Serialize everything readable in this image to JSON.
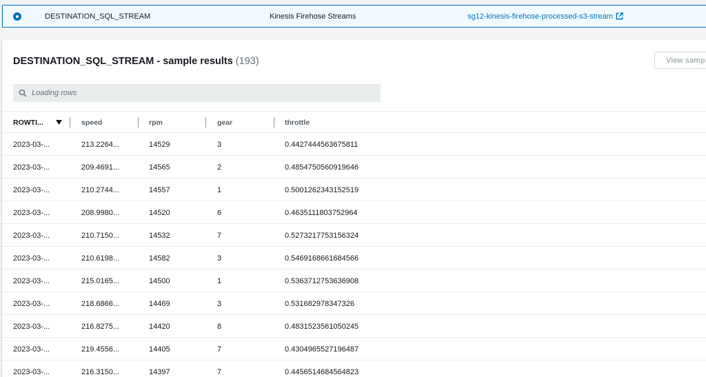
{
  "destination": {
    "name": "DESTINATION_SQL_STREAM",
    "type": "Kinesis Firehose Streams",
    "link": "sg12-kinesis-firehose-processed-s3-stream"
  },
  "panel": {
    "title": "DESTINATION_SQL_STREAM - sample results",
    "count": "(193)",
    "view_button": "View samp"
  },
  "search": {
    "placeholder": "Loading rows"
  },
  "table": {
    "headers": [
      "ROWTI...",
      "speed",
      "rpm",
      "gear",
      "throttle"
    ],
    "rows": [
      [
        "2023-03-...",
        "213.2264...",
        "14529",
        "3",
        "0.4427444563675811"
      ],
      [
        "2023-03-...",
        "209.4691...",
        "14565",
        "2",
        "0.4854750560919646"
      ],
      [
        "2023-03-...",
        "210.2744...",
        "14557",
        "1",
        "0.5001262343152519"
      ],
      [
        "2023-03-...",
        "208.9980...",
        "14520",
        "6",
        "0.4635111803752964"
      ],
      [
        "2023-03-...",
        "210.7150...",
        "14532",
        "7",
        "0.5273217753156324"
      ],
      [
        "2023-03-...",
        "210.6198...",
        "14582",
        "3",
        "0.5469168661684566"
      ],
      [
        "2023-03-...",
        "215.0165...",
        "14500",
        "1",
        "0.5363712753636908"
      ],
      [
        "2023-03-...",
        "218.6866...",
        "14469",
        "3",
        "0.531682978347326"
      ],
      [
        "2023-03-...",
        "216.8275...",
        "14420",
        "8",
        "0.4831523561050245"
      ],
      [
        "2023-03-...",
        "219.4556...",
        "14405",
        "7",
        "0.4304965527196487"
      ],
      [
        "2023-03-...",
        "216.3150...",
        "14397",
        "7",
        "0.4456514684564823"
      ]
    ]
  },
  "colors": {
    "accent": "#0073bb",
    "selected_bg": "#f1faff",
    "page_bg": "#f2f3f3"
  },
  "icons": {
    "radio": "radio-selected-icon",
    "external": "external-link-icon",
    "search": "search-icon",
    "sort": "sort-descending-icon"
  }
}
